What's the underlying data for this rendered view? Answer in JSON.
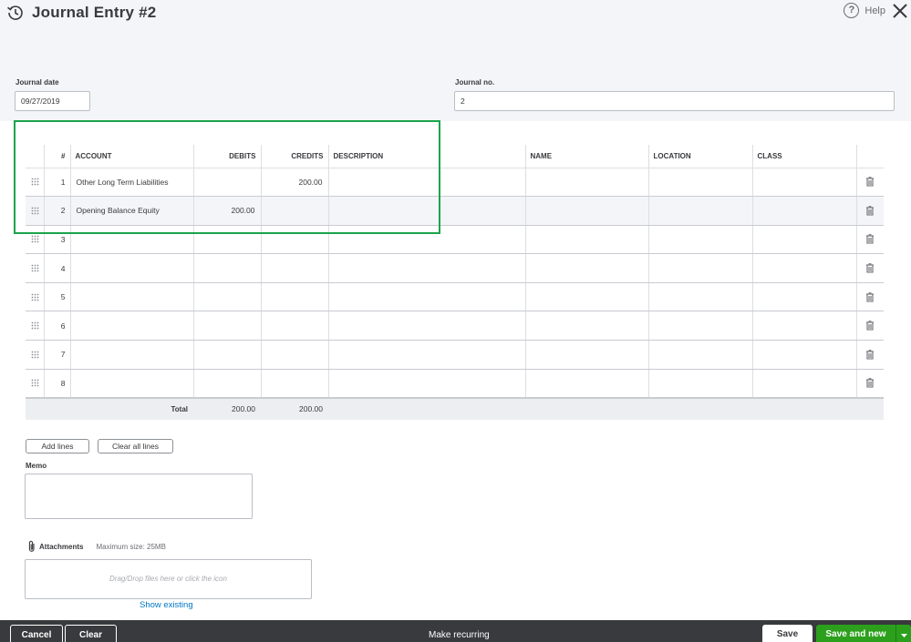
{
  "header": {
    "title": "Journal Entry #2",
    "help_label": "Help"
  },
  "form": {
    "journal_date_label": "Journal date",
    "journal_date_value": "09/27/2019",
    "journal_no_label": "Journal no.",
    "journal_no_value": "2"
  },
  "table": {
    "columns": [
      "#",
      "ACCOUNT",
      "DEBITS",
      "CREDITS",
      "DESCRIPTION",
      "NAME",
      "LOCATION",
      "CLASS"
    ],
    "rows": [
      {
        "n": "1",
        "account": "Other Long Term Liabilities",
        "debits": "",
        "credits": "200.00",
        "description": "",
        "name": "",
        "location": "",
        "class": ""
      },
      {
        "n": "2",
        "account": "Opening Balance Equity",
        "debits": "200.00",
        "credits": "",
        "description": "",
        "name": "",
        "location": "",
        "class": ""
      },
      {
        "n": "3",
        "account": "",
        "debits": "",
        "credits": "",
        "description": "",
        "name": "",
        "location": "",
        "class": ""
      },
      {
        "n": "4",
        "account": "",
        "debits": "",
        "credits": "",
        "description": "",
        "name": "",
        "location": "",
        "class": ""
      },
      {
        "n": "5",
        "account": "",
        "debits": "",
        "credits": "",
        "description": "",
        "name": "",
        "location": "",
        "class": ""
      },
      {
        "n": "6",
        "account": "",
        "debits": "",
        "credits": "",
        "description": "",
        "name": "",
        "location": "",
        "class": ""
      },
      {
        "n": "7",
        "account": "",
        "debits": "",
        "credits": "",
        "description": "",
        "name": "",
        "location": "",
        "class": ""
      },
      {
        "n": "8",
        "account": "",
        "debits": "",
        "credits": "",
        "description": "",
        "name": "",
        "location": "",
        "class": ""
      }
    ],
    "total_label": "Total",
    "total_debits": "200.00",
    "total_credits": "200.00"
  },
  "actions": {
    "add_lines": "Add lines",
    "clear_all_lines": "Clear all lines"
  },
  "memo": {
    "label": "Memo"
  },
  "attachments": {
    "label": "Attachments",
    "max_size": "Maximum size: 25MB",
    "drop_hint": "Drag/Drop files here or click the icon",
    "show_existing": "Show existing"
  },
  "footer": {
    "cancel": "Cancel",
    "clear": "Clear",
    "make_recurring": "Make recurring",
    "save": "Save",
    "save_and_new": "Save and new"
  },
  "icons": {
    "history": "history-icon",
    "help": "help-icon",
    "close": "close-icon",
    "drag": "drag-handle-icon",
    "trash": "trash-icon",
    "paperclip": "paperclip-icon",
    "caret": "caret-down-icon"
  },
  "colors": {
    "highlight": "#1aa44a",
    "primary_green": "#2ca01c",
    "link": "#0077c5",
    "footer_bg": "#393a3d"
  }
}
